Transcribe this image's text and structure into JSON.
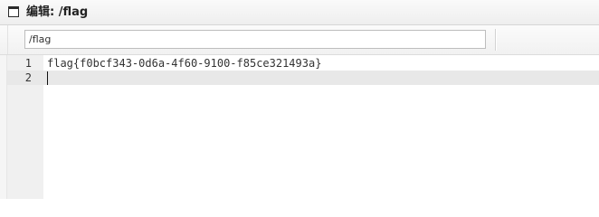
{
  "window": {
    "icon": "window-icon",
    "title": "编辑: /flag"
  },
  "toolbar": {
    "path_value": "/flag"
  },
  "editor": {
    "lines": [
      {
        "number": "1",
        "text": "flag{f0bcf343-0d6a-4f60-9100-f85ce321493a}"
      },
      {
        "number": "2",
        "text": ""
      }
    ],
    "active_line": 2
  }
}
